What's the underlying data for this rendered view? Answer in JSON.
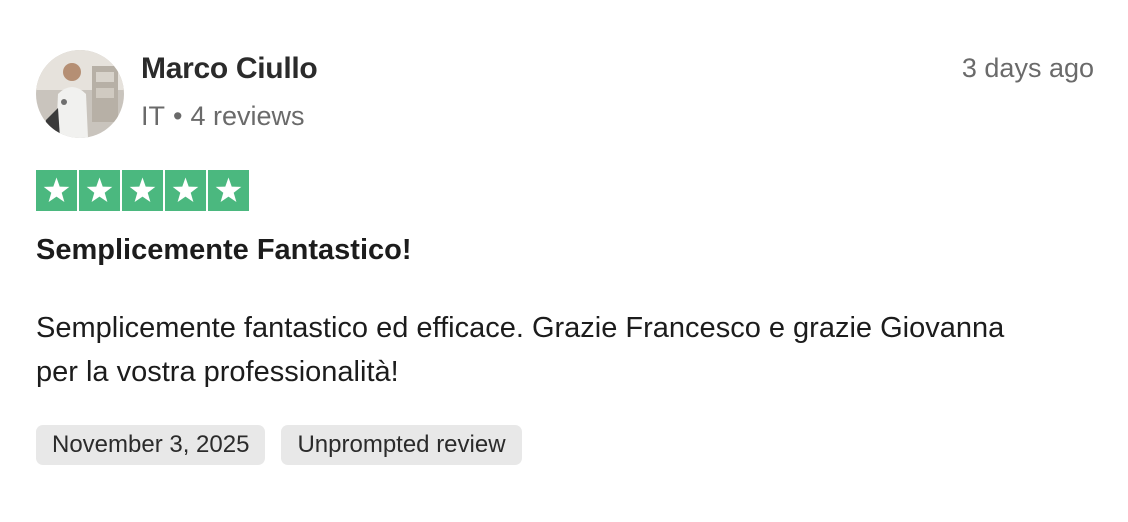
{
  "reviewer": {
    "name": "Marco Ciullo",
    "country": "IT",
    "separator": "•",
    "reviews_count": "4 reviews"
  },
  "timestamp": "3 days ago",
  "rating": {
    "stars": 5,
    "max": 5,
    "color": "#4bb87f"
  },
  "review": {
    "title": "Semplicemente Fantastico!",
    "body": "Semplicemente fantastico ed efficace. Grazie Francesco e grazie Giovanna per la vostra professionalità!"
  },
  "tags": {
    "date": "November 3, 2025",
    "source": "Unprompted review"
  },
  "icons": {
    "star": "star-icon",
    "avatar": "avatar-photo"
  }
}
